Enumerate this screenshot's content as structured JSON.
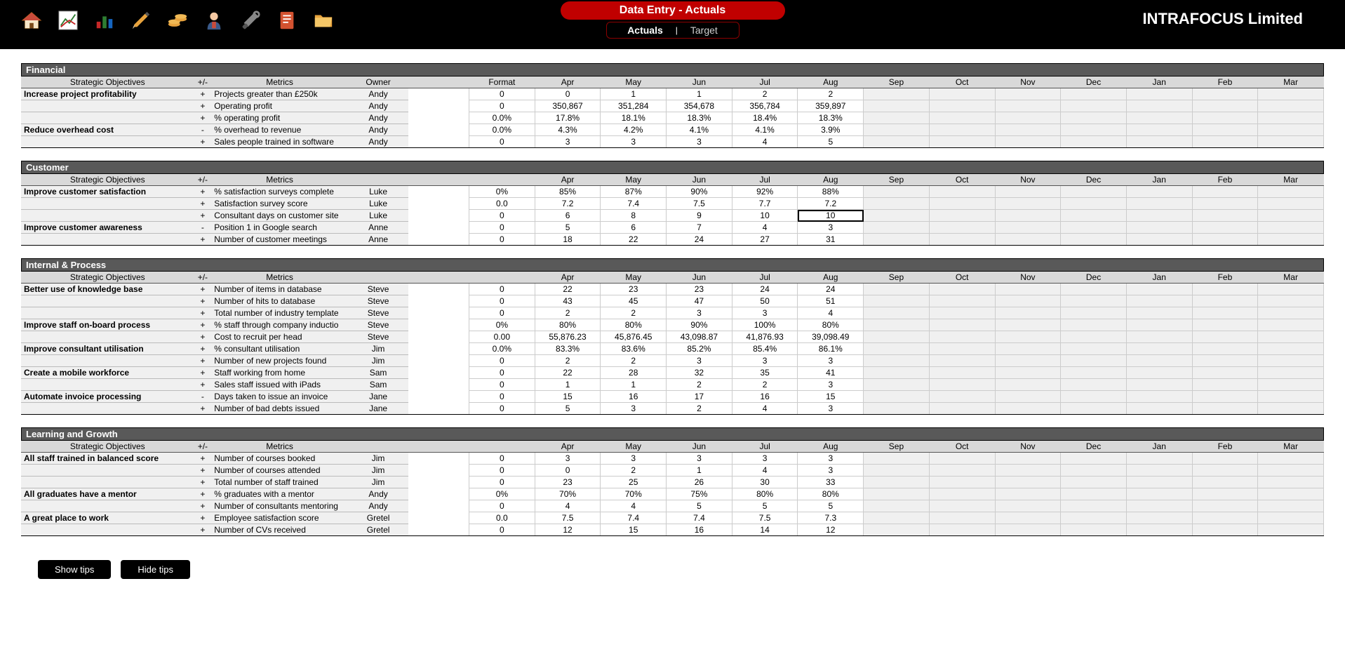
{
  "header": {
    "title": "Data Entry - Actuals",
    "tabs": [
      {
        "label": "Actuals",
        "active": true
      },
      {
        "label": "Target",
        "active": false
      }
    ],
    "brand": "INTRAFOCUS Limited"
  },
  "columns": {
    "strategic": "Strategic Objectives",
    "pm": "+/-",
    "metrics": "Metrics",
    "owner": "Owner",
    "format": "Format",
    "months": [
      "Apr",
      "May",
      "Jun",
      "Jul",
      "Aug",
      "Sep",
      "Oct",
      "Nov",
      "Dec",
      "Jan",
      "Feb",
      "Mar"
    ]
  },
  "sections": [
    {
      "name": "Financial",
      "show_owner_header": true,
      "show_format_header": true,
      "rows": [
        {
          "objective": "Increase project profitability",
          "pm": "+",
          "metric": "Projects greater than £250k",
          "owner": "Andy",
          "format": "0",
          "values": [
            "0",
            "1",
            "1",
            "2",
            "2",
            "",
            "",
            "",
            "",
            "",
            "",
            ""
          ]
        },
        {
          "objective": "",
          "pm": "+",
          "metric": "Operating profit",
          "owner": "Andy",
          "format": "0",
          "values": [
            "350,867",
            "351,284",
            "354,678",
            "356,784",
            "359,897",
            "",
            "",
            "",
            "",
            "",
            "",
            ""
          ]
        },
        {
          "objective": "",
          "pm": "+",
          "metric": "% operating profit",
          "owner": "Andy",
          "format": "0.0%",
          "values": [
            "17.8%",
            "18.1%",
            "18.3%",
            "18.4%",
            "18.3%",
            "",
            "",
            "",
            "",
            "",
            "",
            ""
          ]
        },
        {
          "objective": "Reduce overhead cost",
          "pm": "-",
          "metric": "% overhead to revenue",
          "owner": "Andy",
          "format": "0.0%",
          "values": [
            "4.3%",
            "4.2%",
            "4.1%",
            "4.1%",
            "3.9%",
            "",
            "",
            "",
            "",
            "",
            "",
            ""
          ]
        },
        {
          "objective": "",
          "pm": "+",
          "metric": "Sales people trained in software",
          "owner": "Andy",
          "format": "0",
          "values": [
            "3",
            "3",
            "3",
            "4",
            "5",
            "",
            "",
            "",
            "",
            "",
            "",
            ""
          ]
        }
      ]
    },
    {
      "name": "Customer",
      "show_owner_header": false,
      "show_format_header": false,
      "rows": [
        {
          "objective": "Improve customer satisfaction",
          "pm": "+",
          "metric": "% satisfaction surveys complete",
          "owner": "Luke",
          "format": "0%",
          "values": [
            "85%",
            "87%",
            "90%",
            "92%",
            "88%",
            "",
            "",
            "",
            "",
            "",
            "",
            ""
          ]
        },
        {
          "objective": "",
          "pm": "+",
          "metric": "Satisfaction survey score",
          "owner": "Luke",
          "format": "0.0",
          "values": [
            "7.2",
            "7.4",
            "7.5",
            "7.7",
            "7.2",
            "",
            "",
            "",
            "",
            "",
            "",
            ""
          ]
        },
        {
          "objective": "",
          "pm": "+",
          "metric": "Consultant days on customer site",
          "owner": "Luke",
          "format": "0",
          "values": [
            "6",
            "8",
            "9",
            "10",
            "10",
            "",
            "",
            "",
            "",
            "",
            "",
            ""
          ],
          "selected": 4
        },
        {
          "objective": "Improve customer awareness",
          "pm": "-",
          "metric": "Position 1 in Google search",
          "owner": "Anne",
          "format": "0",
          "values": [
            "5",
            "6",
            "7",
            "4",
            "3",
            "",
            "",
            "",
            "",
            "",
            "",
            ""
          ]
        },
        {
          "objective": "",
          "pm": "+",
          "metric": "Number of customer meetings",
          "owner": "Anne",
          "format": "0",
          "values": [
            "18",
            "22",
            "24",
            "27",
            "31",
            "",
            "",
            "",
            "",
            "",
            "",
            ""
          ]
        }
      ]
    },
    {
      "name": "Internal & Process",
      "show_owner_header": false,
      "show_format_header": false,
      "rows": [
        {
          "objective": "Better use of knowledge base",
          "pm": "+",
          "metric": "Number of items in database",
          "owner": "Steve",
          "format": "0",
          "values": [
            "22",
            "23",
            "23",
            "24",
            "24",
            "",
            "",
            "",
            "",
            "",
            "",
            ""
          ]
        },
        {
          "objective": "",
          "pm": "+",
          "metric": "Number of hits to database",
          "owner": "Steve",
          "format": "0",
          "values": [
            "43",
            "45",
            "47",
            "50",
            "51",
            "",
            "",
            "",
            "",
            "",
            "",
            ""
          ]
        },
        {
          "objective": "",
          "pm": "+",
          "metric": "Total number of industry template",
          "owner": "Steve",
          "format": "0",
          "values": [
            "2",
            "2",
            "3",
            "3",
            "4",
            "",
            "",
            "",
            "",
            "",
            "",
            ""
          ]
        },
        {
          "objective": "Improve staff on-board process",
          "pm": "+",
          "metric": "% staff through company inductio",
          "owner": "Steve",
          "format": "0%",
          "values": [
            "80%",
            "80%",
            "90%",
            "100%",
            "80%",
            "",
            "",
            "",
            "",
            "",
            "",
            ""
          ]
        },
        {
          "objective": "",
          "pm": "+",
          "metric": "Cost to recruit per head",
          "owner": "Steve",
          "format": "0.00",
          "values": [
            "55,876.23",
            "45,876.45",
            "43,098.87",
            "41,876.93",
            "39,098.49",
            "",
            "",
            "",
            "",
            "",
            "",
            ""
          ]
        },
        {
          "objective": "Improve consultant utilisation",
          "pm": "+",
          "metric": "% consultant utilisation",
          "owner": "Jim",
          "format": "0.0%",
          "values": [
            "83.3%",
            "83.6%",
            "85.2%",
            "85.4%",
            "86.1%",
            "",
            "",
            "",
            "",
            "",
            "",
            ""
          ]
        },
        {
          "objective": "",
          "pm": "+",
          "metric": "Number of new projects found",
          "owner": "Jim",
          "format": "0",
          "values": [
            "2",
            "2",
            "3",
            "3",
            "3",
            "",
            "",
            "",
            "",
            "",
            "",
            ""
          ]
        },
        {
          "objective": "Create a mobile workforce",
          "pm": "+",
          "metric": "Staff working from home",
          "owner": "Sam",
          "format": "0",
          "values": [
            "22",
            "28",
            "32",
            "35",
            "41",
            "",
            "",
            "",
            "",
            "",
            "",
            ""
          ]
        },
        {
          "objective": "",
          "pm": "+",
          "metric": "Sales staff issued with iPads",
          "owner": "Sam",
          "format": "0",
          "values": [
            "1",
            "1",
            "2",
            "2",
            "3",
            "",
            "",
            "",
            "",
            "",
            "",
            ""
          ]
        },
        {
          "objective": "Automate invoice processing",
          "pm": "-",
          "metric": "Days taken to issue an invoice",
          "owner": "Jane",
          "format": "0",
          "values": [
            "15",
            "16",
            "17",
            "16",
            "15",
            "",
            "",
            "",
            "",
            "",
            "",
            ""
          ]
        },
        {
          "objective": "",
          "pm": "+",
          "metric": "Number of bad debts issued",
          "owner": "Jane",
          "format": "0",
          "values": [
            "5",
            "3",
            "2",
            "4",
            "3",
            "",
            "",
            "",
            "",
            "",
            "",
            ""
          ]
        }
      ]
    },
    {
      "name": "Learning and Growth",
      "show_owner_header": false,
      "show_format_header": false,
      "rows": [
        {
          "objective": "All staff trained in balanced score",
          "pm": "+",
          "metric": "Number of courses booked",
          "owner": "Jim",
          "format": "0",
          "values": [
            "3",
            "3",
            "3",
            "3",
            "3",
            "",
            "",
            "",
            "",
            "",
            "",
            ""
          ]
        },
        {
          "objective": "",
          "pm": "+",
          "metric": "Number of courses attended",
          "owner": "Jim",
          "format": "0",
          "values": [
            "0",
            "2",
            "1",
            "4",
            "3",
            "",
            "",
            "",
            "",
            "",
            "",
            ""
          ]
        },
        {
          "objective": "",
          "pm": "+",
          "metric": "Total number of staff trained",
          "owner": "Jim",
          "format": "0",
          "values": [
            "23",
            "25",
            "26",
            "30",
            "33",
            "",
            "",
            "",
            "",
            "",
            "",
            ""
          ]
        },
        {
          "objective": "All graduates have a mentor",
          "pm": "+",
          "metric": "% graduates with a mentor",
          "owner": "Andy",
          "format": "0%",
          "values": [
            "70%",
            "70%",
            "75%",
            "80%",
            "80%",
            "",
            "",
            "",
            "",
            "",
            "",
            ""
          ]
        },
        {
          "objective": "",
          "pm": "+",
          "metric": "Number of consultants mentoring",
          "owner": "Andy",
          "format": "0",
          "values": [
            "4",
            "4",
            "5",
            "5",
            "5",
            "",
            "",
            "",
            "",
            "",
            "",
            ""
          ]
        },
        {
          "objective": "A great place to work",
          "pm": "+",
          "metric": "Employee satisfaction score",
          "owner": "Gretel",
          "format": "0.0",
          "values": [
            "7.5",
            "7.4",
            "7.4",
            "7.5",
            "7.3",
            "",
            "",
            "",
            "",
            "",
            "",
            ""
          ]
        },
        {
          "objective": "",
          "pm": "+",
          "metric": "Number of CVs received",
          "owner": "Gretel",
          "format": "0",
          "values": [
            "12",
            "15",
            "16",
            "14",
            "12",
            "",
            "",
            "",
            "",
            "",
            "",
            ""
          ]
        }
      ]
    }
  ],
  "footer": {
    "show_tips": "Show tips",
    "hide_tips": "Hide tips"
  }
}
